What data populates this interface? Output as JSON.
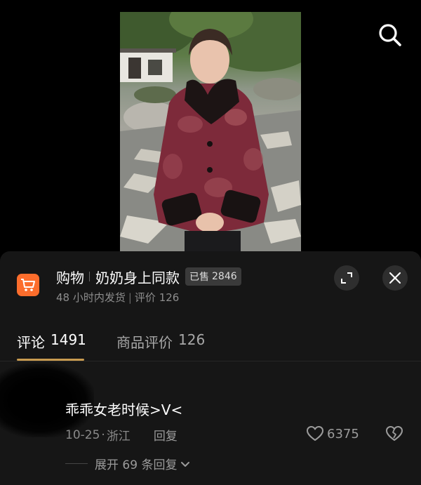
{
  "video": {
    "search_icon": "search-icon"
  },
  "shop": {
    "tag": "购物",
    "name": "奶奶身上同款",
    "sold": "已售",
    "sold_count": "2846",
    "sub_shipping": "48 小时内发货",
    "sub_review": "评价 126",
    "cart_color": "#fc6d2c"
  },
  "tabs": [
    {
      "label": "评论",
      "count": "1491"
    },
    {
      "label": "商品评价",
      "count": "126"
    }
  ],
  "comment": {
    "text": "乖乖女老时候>V<",
    "date": "10-25",
    "location": "浙江",
    "reply_label": "回复",
    "likes": "6375",
    "expand_label": "展开 69 条回复"
  },
  "accent": "#c89b50"
}
